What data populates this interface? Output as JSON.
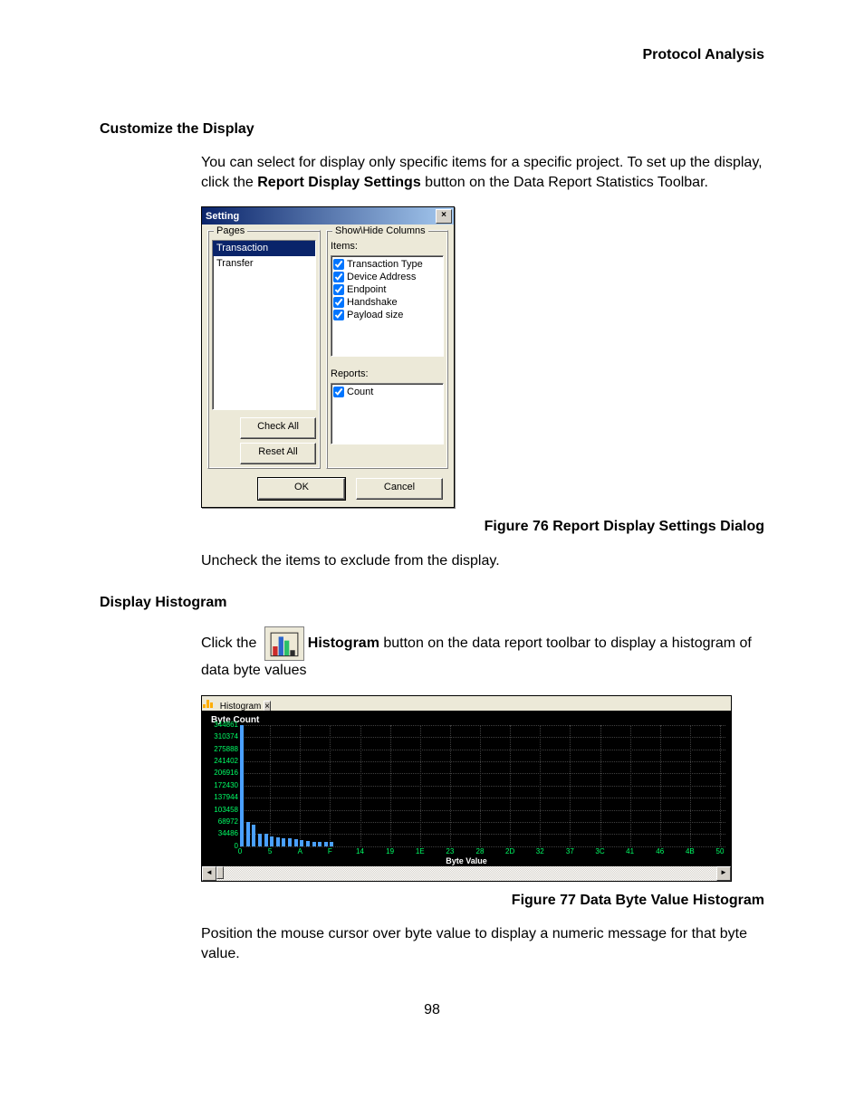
{
  "header": {
    "running": "Protocol Analysis"
  },
  "section1": {
    "title": "Customize the Display",
    "p1a": "You can select for display only specific items for a specific project. To set up the display, click the ",
    "p1b": "Report Display Settings",
    "p1c": " button on the Data Report Statistics Toolbar."
  },
  "dialog": {
    "title": "Setting",
    "pages_legend": "Pages",
    "pages": [
      {
        "label": "Transaction",
        "selected": true
      },
      {
        "label": "Transfer",
        "selected": false
      }
    ],
    "columns_legend": "Show\\Hide Columns",
    "items_label": "Items:",
    "items": [
      {
        "label": "Transaction Type",
        "checked": true
      },
      {
        "label": "Device Address",
        "checked": true
      },
      {
        "label": "Endpoint",
        "checked": true
      },
      {
        "label": "Handshake",
        "checked": true
      },
      {
        "label": "Payload size",
        "checked": true
      }
    ],
    "reports_label": "Reports:",
    "reports": [
      {
        "label": "Count",
        "checked": true
      }
    ],
    "btn_checkall": "Check All",
    "btn_resetall": "Reset All",
    "btn_ok": "OK",
    "btn_cancel": "Cancel"
  },
  "figure76": "Figure  76  Report Display Settings Dialog",
  "after1": "Uncheck the items to exclude from the display.",
  "section2": {
    "title": "Display Histogram",
    "p1a": "Click the ",
    "p1b": "Histogram",
    "p1c": " button on the data report toolbar to display a histogram of data byte values"
  },
  "histwin": {
    "title": "Histogram",
    "ytitle": "Byte Count",
    "xtitle": "Byte Value"
  },
  "chart_data": {
    "type": "bar",
    "title": "Byte Count",
    "xlabel": "Byte Value",
    "ylabel": "Byte Count",
    "ylim": [
      0,
      344861
    ],
    "y_ticks": [
      0,
      34486,
      68972,
      103458,
      137944,
      172430,
      206916,
      241402,
      275888,
      310374,
      344861
    ],
    "x_ticks_hex": [
      "0",
      "5",
      "A",
      "F",
      "14",
      "19",
      "1E",
      "23",
      "28",
      "2D",
      "32",
      "37",
      "3C",
      "41",
      "46",
      "4B",
      "50"
    ],
    "categories_hex": [
      "0",
      "1",
      "2",
      "3",
      "4",
      "5",
      "6",
      "7",
      "8",
      "9",
      "A",
      "B",
      "C",
      "D",
      "E",
      "F"
    ],
    "values": [
      344861,
      68972,
      60000,
      34486,
      34486,
      27000,
      24000,
      22000,
      22000,
      20000,
      18000,
      15000,
      13000,
      12000,
      12000,
      11000
    ]
  },
  "figure77": "Figure  77  Data Byte Value Histogram",
  "after2": "Position the mouse cursor over byte value to display a numeric message for that byte value.",
  "page_number": "98"
}
